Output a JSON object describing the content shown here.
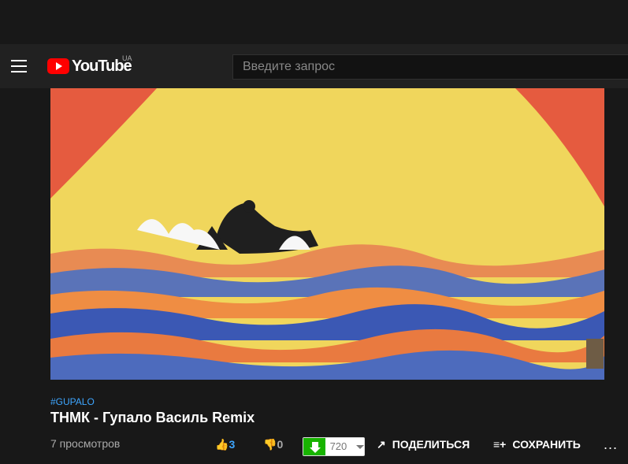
{
  "header": {
    "logo_text": "YouTube",
    "country_code": "UA",
    "search_placeholder": "Введите запрос"
  },
  "video": {
    "hashtag": "#GUPALO",
    "title": "ТНМК - Гупало Василь Remix",
    "views": "7 просмотров",
    "likes": "3",
    "dislikes": "0",
    "download_quality": "720",
    "share_label": "ПОДЕЛИТЬСЯ",
    "save_label": "СОХРАНИТЬ",
    "more_label": "..."
  }
}
